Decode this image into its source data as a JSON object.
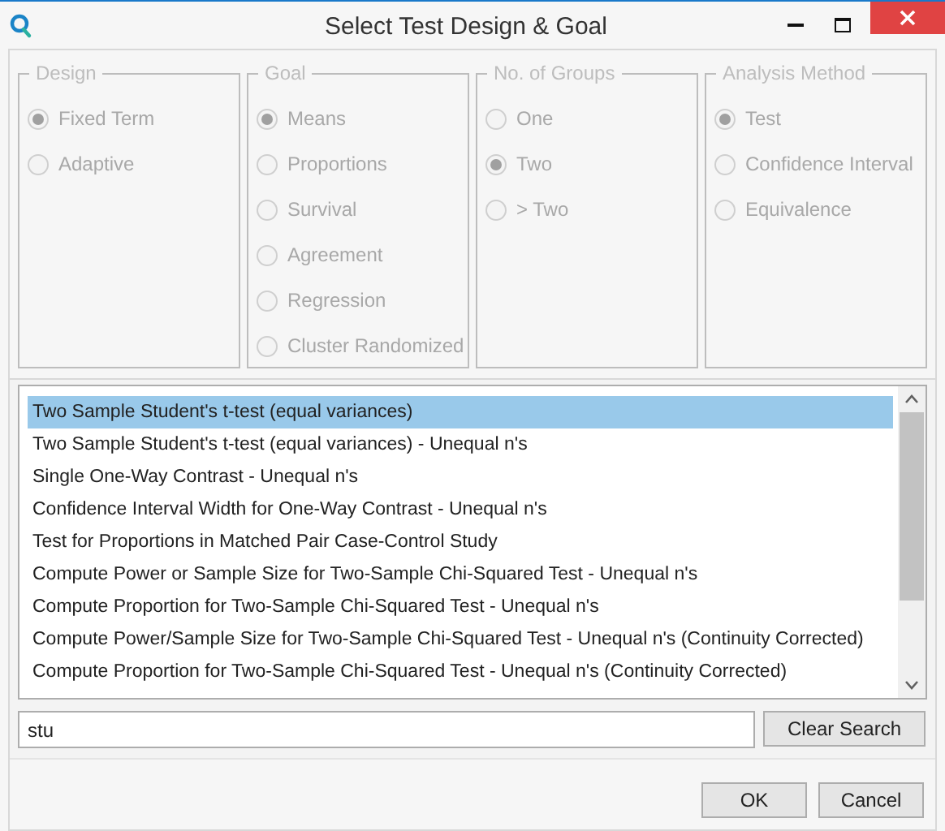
{
  "window": {
    "title": "Select Test Design & Goal"
  },
  "groups": [
    {
      "title": "Design",
      "disabled": true,
      "options": [
        {
          "label": "Fixed Term",
          "selected": true
        },
        {
          "label": "Adaptive",
          "selected": false
        }
      ]
    },
    {
      "title": "Goal",
      "disabled": true,
      "options": [
        {
          "label": "Means",
          "selected": true
        },
        {
          "label": "Proportions",
          "selected": false
        },
        {
          "label": "Survival",
          "selected": false
        },
        {
          "label": "Agreement",
          "selected": false
        },
        {
          "label": "Regression",
          "selected": false
        },
        {
          "label": "Cluster Randomized",
          "selected": false
        }
      ]
    },
    {
      "title": "No. of Groups",
      "disabled": true,
      "options": [
        {
          "label": "One",
          "selected": false
        },
        {
          "label": "Two",
          "selected": true
        },
        {
          "label": "> Two",
          "selected": false
        }
      ]
    },
    {
      "title": "Analysis Method",
      "disabled": true,
      "options": [
        {
          "label": "Test",
          "selected": true
        },
        {
          "label": "Confidence Interval",
          "selected": false
        },
        {
          "label": "Equivalence",
          "selected": false
        }
      ]
    }
  ],
  "procedures": [
    {
      "label": "Two Sample Student's t-test (equal variances)",
      "selected": true
    },
    {
      "label": "Two Sample Student's t-test (equal variances) - Unequal n's",
      "selected": false
    },
    {
      "label": "Single One-Way Contrast - Unequal n's",
      "selected": false
    },
    {
      "label": "Confidence Interval Width for One-Way Contrast - Unequal n's",
      "selected": false
    },
    {
      "label": "Test for Proportions in Matched Pair Case-Control Study",
      "selected": false
    },
    {
      "label": "Compute Power or Sample Size for Two-Sample Chi-Squared Test - Unequal n's",
      "selected": false
    },
    {
      "label": "Compute Proportion for Two-Sample Chi-Squared Test - Unequal n's",
      "selected": false
    },
    {
      "label": "Compute Power/Sample Size for Two-Sample Chi-Squared Test - Unequal n's (Continuity Corrected)",
      "selected": false
    },
    {
      "label": "Compute Proportion for Two-Sample Chi-Squared Test - Unequal n's (Continuity Corrected)",
      "selected": false
    }
  ],
  "search": {
    "value": "stu"
  },
  "buttons": {
    "clear": "Clear Search",
    "ok": "OK",
    "cancel": "Cancel"
  }
}
